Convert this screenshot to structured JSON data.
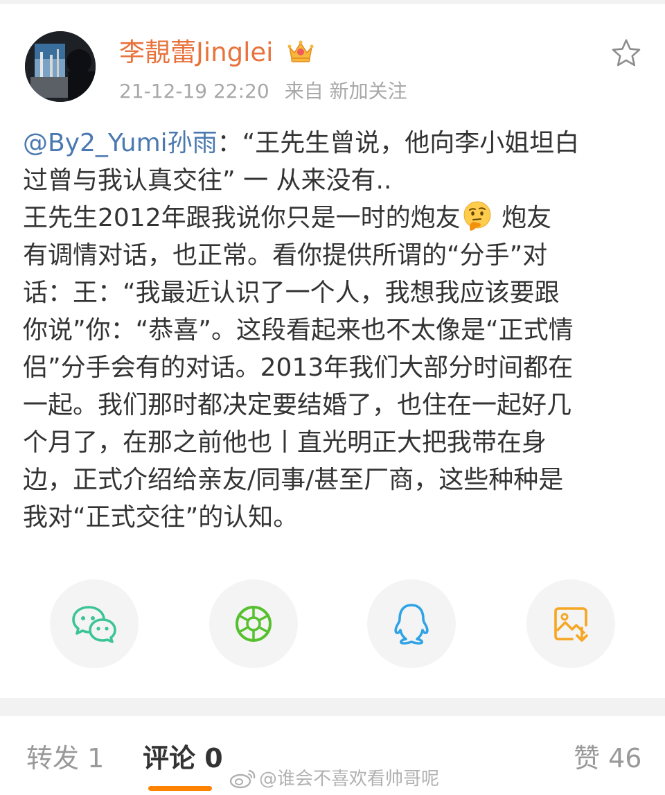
{
  "post": {
    "author": "李靚蕾Jinglei",
    "timestamp": "21-12-19 22:20",
    "source": "来自 新加关注",
    "mention": "@By2_Yumi孙雨",
    "lines": [
      {
        "pre": "：“王先生曾说，他向李小姐坦白"
      },
      {
        "text": "过曾与我认真交往” 一 从来没有.."
      },
      {
        "pre": "王先生2012年跟我说你只是一时的炮友",
        "emoji": "thinking-face",
        "post": " 炮友"
      },
      {
        "text": "有调情对话，也正常。看你提供所谓的“分手”对"
      },
      {
        "text": "话：王：“我最近认识了一个人，我想我应该要跟"
      },
      {
        "text": "你说”你：“恭喜”。这段看起来也不太像是“正式情"
      },
      {
        "text": "侣”分手会有的对话。2013年我们大部分时间都在"
      },
      {
        "text": "一起。我们那时都决定要结婚了，也住在一起好几"
      },
      {
        "text": "个月了，在那之前他也丨直光明正大把我带在身"
      },
      {
        "text": "边，正式介绍给亲友/同事/甚至厂商，这些种种是"
      },
      {
        "text": "我对“正式交往”的认知。"
      }
    ]
  },
  "share": [
    {
      "icon": "wechat-icon",
      "color": "#3cc497"
    },
    {
      "icon": "moments-icon",
      "color": "#56c02e"
    },
    {
      "icon": "qq-icon",
      "color": "#2fa3e6"
    },
    {
      "icon": "save-image-icon",
      "color": "#f5a623"
    }
  ],
  "tabs": {
    "repost": "转发 1",
    "comment": "评论 0",
    "like": "赞 46"
  },
  "watermark": "@谁会不喜欢看帅哥呢",
  "colors": {
    "username": "#e8723b",
    "mention": "#4a79b0",
    "accent": "#ff8200"
  }
}
